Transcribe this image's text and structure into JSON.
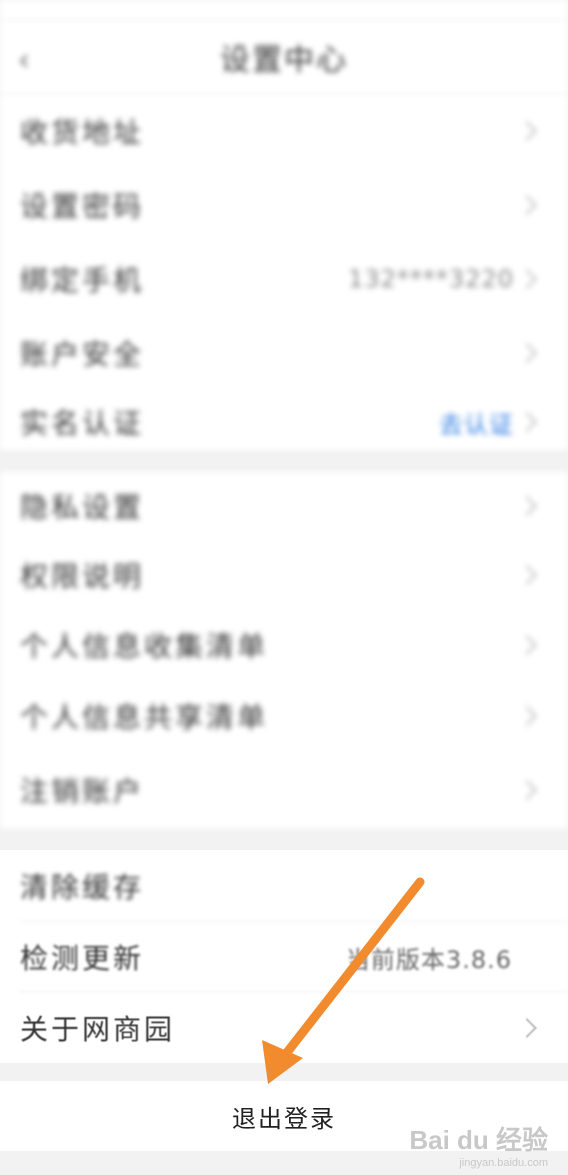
{
  "header": {
    "title": "设置中心",
    "back_icon": "chevron-left-icon"
  },
  "group_one": [
    {
      "label": "收货地址",
      "value": ""
    },
    {
      "label": "设置密码",
      "value": ""
    },
    {
      "label": "绑定手机",
      "value": "132****3220"
    },
    {
      "label": "账户安全",
      "value": ""
    },
    {
      "label": "实名认证",
      "value": "去认证",
      "value_color": "#2a7ae2"
    }
  ],
  "group_two": [
    {
      "label": "隐私设置"
    },
    {
      "label": "权限说明"
    },
    {
      "label": "个人信息收集清单"
    },
    {
      "label": "个人信息共享清单"
    },
    {
      "label": "注销账户"
    }
  ],
  "group_three": [
    {
      "label": "清除缓存",
      "value": ""
    },
    {
      "label": "检测更新",
      "value": "当前版本3.8.6"
    },
    {
      "label": "关于网商园",
      "value": ""
    }
  ],
  "logout": {
    "label": "退出登录"
  },
  "annotation": {
    "arrow_color": "#f28a2e"
  },
  "watermark": {
    "brand": "Bai du 经验",
    "url": "jingyan.baidu.com"
  }
}
